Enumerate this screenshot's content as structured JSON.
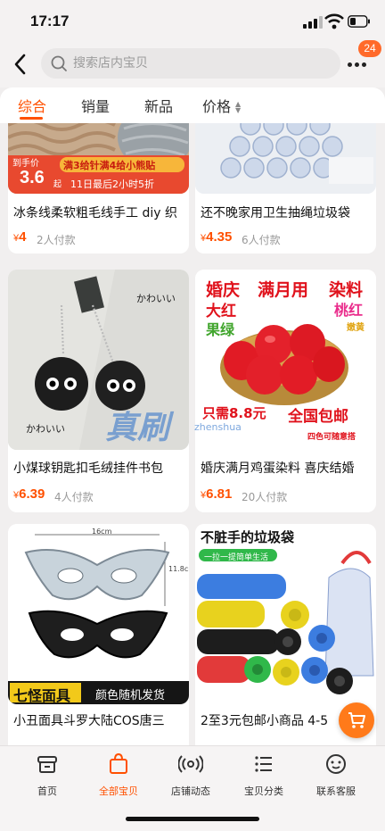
{
  "status": {
    "time": "17:17"
  },
  "header": {
    "search_placeholder": "搜索店内宝贝",
    "cart_badge": "24"
  },
  "tabs": [
    {
      "label": "综合"
    },
    {
      "label": "销量"
    },
    {
      "label": "新品"
    },
    {
      "label": "价格"
    }
  ],
  "products": [
    {
      "title": "冰条线柔软粗毛线手工 diy 织",
      "price": "4",
      "paid": "2人付款",
      "promo": {
        "tag": "到手价",
        "price": "3.6",
        "unit": "起",
        "line1": "满3给针满4给小熊贴",
        "line2": "11日最后2小时5折"
      }
    },
    {
      "title": "还不晚家用卫生抽绳垃圾袋",
      "price": "4.35",
      "paid": "6人付款"
    },
    {
      "title": "小煤球钥匙扣毛绒挂件书包",
      "price": "6.39",
      "paid": "4人付款",
      "labels": {
        "top": "かわいい",
        "bottom": "かわいい"
      }
    },
    {
      "title": "婚庆满月鸡蛋染料 喜庆结婚",
      "price": "6.81",
      "paid": "20人付款",
      "labels": {
        "l1a": "婚庆",
        "l1b": "满月用",
        "l1c": "染料",
        "l2a": "大红",
        "l2b": "桃红",
        "l3a": "果绿",
        "l3b": "嫩黄",
        "promo": "只需8.8元",
        "ship": "全国包邮",
        "note": "四色可随意搭"
      }
    },
    {
      "title": "小丑面具斗罗大陆COS唐三",
      "price": "",
      "paid": "",
      "labels": {
        "name": "七怪面具",
        "note": "颜色随机发货",
        "w": "16cm",
        "h": "11.8cm"
      }
    },
    {
      "title": "2至3元包邮小商品 4-5",
      "price": "",
      "paid": "",
      "labels": {
        "top": "不脏手的垃圾袋",
        "sub": "一拉一提简单生活"
      }
    }
  ],
  "bottom_nav": [
    {
      "label": "首页"
    },
    {
      "label": "全部宝贝"
    },
    {
      "label": "店铺动态"
    },
    {
      "label": "宝贝分类"
    },
    {
      "label": "联系客服"
    }
  ],
  "watermark": {
    "main": "真刷",
    "sub": "zhenshua"
  },
  "colors": {
    "accent": "#ff5000",
    "bg": "#f1efef"
  }
}
